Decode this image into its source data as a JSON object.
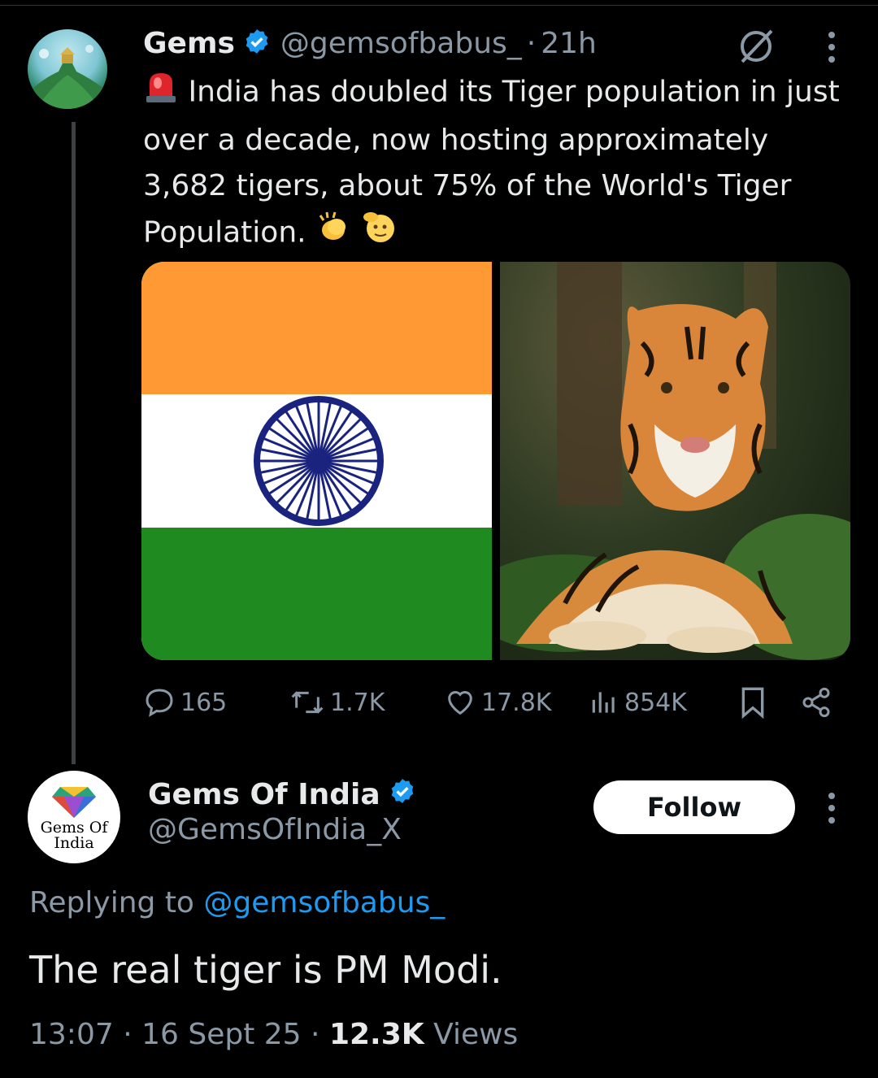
{
  "original_tweet": {
    "author_name": "Gems",
    "handle": "@gemsofbabus_",
    "separator": "·",
    "time": "21h",
    "text_lead_emoji": "siren-emoji",
    "text": "India has doubled its Tiger population in just over a decade, now hosting approximately 3,682 tigers, about 75% of the World's Tiger Population.",
    "text_trailing_emojis": [
      "clapping-hands-emoji",
      "saluting-face-emoji"
    ],
    "media": [
      {
        "kind": "image",
        "subject": "indian-flag"
      },
      {
        "kind": "image",
        "subject": "tiger"
      }
    ],
    "actions": {
      "replies": "165",
      "reposts": "1.7K",
      "likes": "17.8K",
      "views": "854K"
    }
  },
  "reply": {
    "author_name": "Gems Of India",
    "handle": "@GemsOfIndia_X",
    "avatar_text_line1": "Gems Of",
    "avatar_text_line2": "India",
    "follow_label": "Follow",
    "replying_prefix": "Replying to",
    "replying_mention": "@gemsofbabus_",
    "text": "The real tiger is PM Modi.",
    "time": "13:07",
    "sep1": "·",
    "date": "16 Sept 25",
    "sep2": "·",
    "views_count": "12.3K",
    "views_label": "Views"
  },
  "colors": {
    "background": "#000000",
    "text_primary": "#e7e9ea",
    "text_secondary": "#8b98a5",
    "accent_blue": "#1d9bf0",
    "flag_saffron": "#ff9933",
    "flag_green": "#1f8a1f",
    "chakra_blue": "#1a237e"
  }
}
